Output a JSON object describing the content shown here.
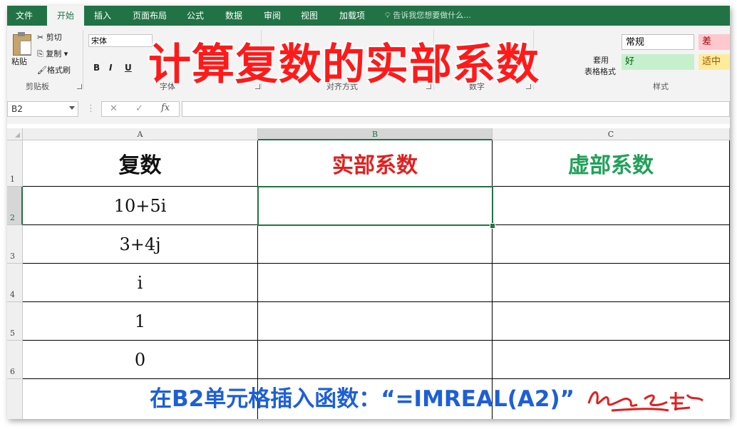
{
  "ribbon_tabs": [
    "文件",
    "开始",
    "插入",
    "页面布局",
    "公式",
    "数据",
    "审阅",
    "视图",
    "加载项"
  ],
  "tell_me": "告诉我您想要做什么...",
  "clipboard": {
    "paste": "粘贴",
    "cut": "剪切",
    "copy": "复制",
    "format_painter": "格式刷",
    "group": "剪贴板"
  },
  "font": {
    "name": "宋体",
    "bold": "B",
    "italic": "I",
    "underline": "U",
    "group": "字体"
  },
  "alignment": {
    "group": "对齐方式"
  },
  "number": {
    "group": "数字"
  },
  "styles": {
    "normal": "常规",
    "bad": "差",
    "good": "好",
    "neutral": "适中",
    "group": "样式",
    "table_format": "套用",
    "table_format2": "表格格式"
  },
  "overlay_title": "计算复数的实部系数",
  "formula_bar": {
    "name_box": "B2",
    "cancel": "✕",
    "enter": "✓",
    "fx": "fx",
    "value": ""
  },
  "columns": [
    "A",
    "B",
    "C"
  ],
  "rows": [
    "1",
    "2",
    "3",
    "4",
    "5",
    "6"
  ],
  "headers": {
    "a": "复数",
    "b": "实部系数",
    "c": "虚部系数"
  },
  "values": [
    "10+5i",
    "3+4j",
    "i",
    "1",
    "0"
  ],
  "instruction": "在B2单元格插入函数：“=IMREAL(A2)”",
  "colors": {
    "accent": "#217346",
    "title_red": "#ff1a1a",
    "header_b": "#e02020",
    "header_c": "#21a05a",
    "instruction_blue": "#1d5fd6"
  }
}
